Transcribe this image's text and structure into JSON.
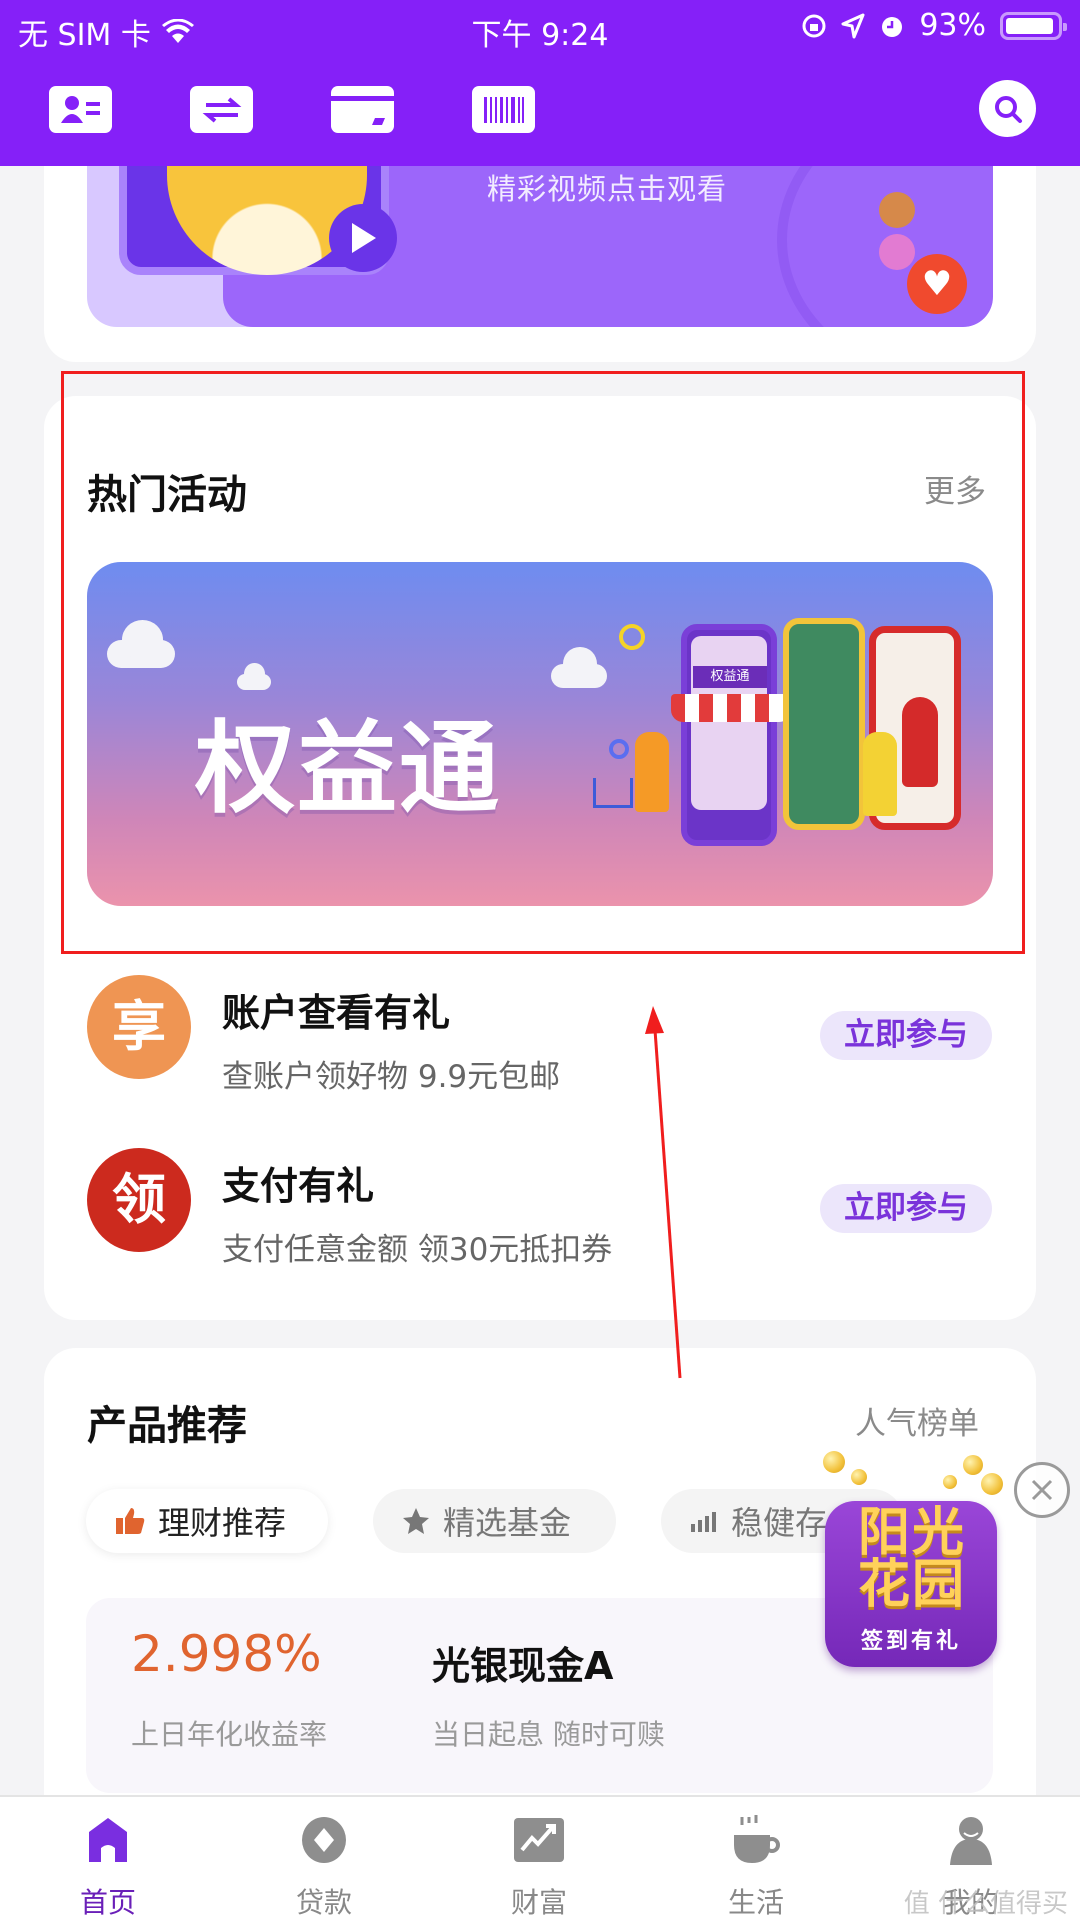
{
  "status_bar": {
    "carrier": "无 SIM 卡",
    "time": "下午 9:24",
    "battery": "93%",
    "battery_level": 0.93
  },
  "header": {
    "icons": [
      "id-card-icon",
      "transfer-icon",
      "bank-card-icon",
      "barcode-icon"
    ],
    "search_icon": "search-icon",
    "color": "#8520f8"
  },
  "video_banner": {
    "caption": "精彩视频点击观看"
  },
  "hot_activities": {
    "title": "热门活动",
    "more": "更多",
    "banner_title": "权益通",
    "banner_shop_sign": "权益通",
    "items": [
      {
        "icon_char": "享",
        "icon_color": "#ef9553",
        "title": "账户查看有礼",
        "subtitle": "查账户领好物 9.9元包邮",
        "button": "立即参与"
      },
      {
        "icon_char": "领",
        "icon_color": "#cc2a1e",
        "title": "支付有礼",
        "subtitle": "支付任意金额 领30元抵扣券",
        "button": "立即参与"
      }
    ]
  },
  "products": {
    "title": "产品推荐",
    "more": "人气榜单",
    "tabs": [
      {
        "label": "理财推荐",
        "icon": "thumbs-up-icon",
        "active": true
      },
      {
        "label": "精选基金",
        "icon": "star-icon",
        "active": false
      },
      {
        "label": "稳健存",
        "icon": "bar-chart-icon",
        "active": false
      }
    ],
    "item": {
      "rate": "2.998%",
      "rate_label": "上日年化收益率",
      "name": "光银现金A",
      "desc": "当日起息 随时可赎"
    }
  },
  "floating_widget": {
    "title_line1": "阳光",
    "title_line2": "花园",
    "subtitle": "签到有礼"
  },
  "tabbar": {
    "items": [
      {
        "label": "首页",
        "icon": "home-icon",
        "active": true
      },
      {
        "label": "贷款",
        "icon": "loan-icon",
        "active": false
      },
      {
        "label": "财富",
        "icon": "wealth-chart-icon",
        "active": false
      },
      {
        "label": "生活",
        "icon": "coffee-cup-icon",
        "active": false
      },
      {
        "label": "我的",
        "icon": "user-icon",
        "active": false
      }
    ]
  },
  "watermark": "值 什么值得买"
}
